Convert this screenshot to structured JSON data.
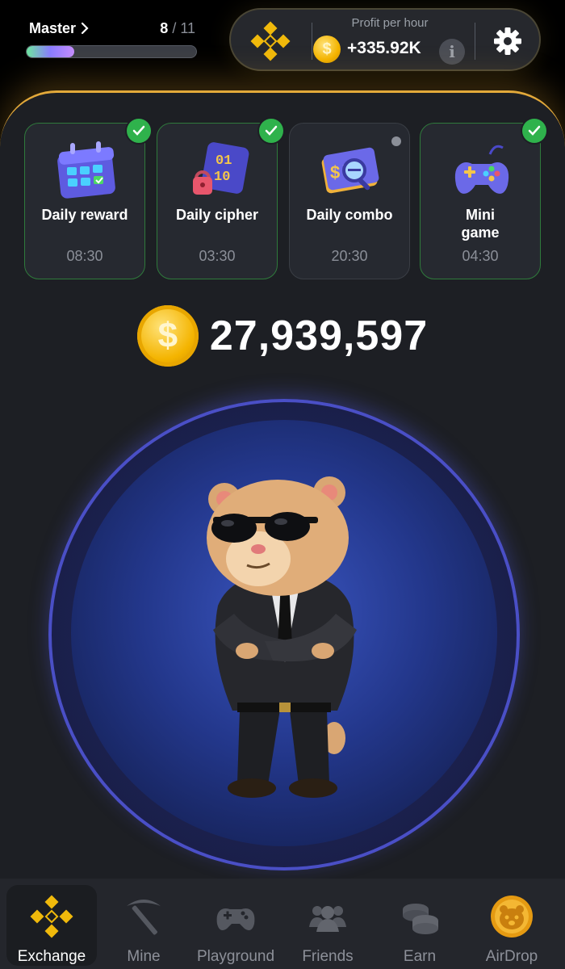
{
  "header": {
    "level_name": "Master",
    "level_current": "8",
    "level_total": "/ 11",
    "level_progress": 0.28,
    "profit_label": "Profit per hour",
    "profit_value": "+335.92K",
    "info_glyph": "i"
  },
  "cards": [
    {
      "title": "Daily reward",
      "time": "08:30",
      "completed": true,
      "icon": "calendar-icon"
    },
    {
      "title": "Daily cipher",
      "time": "03:30",
      "completed": true,
      "icon": "cipher-icon"
    },
    {
      "title": "Daily combo",
      "time": "20:30",
      "completed": false,
      "icon": "combo-icon"
    },
    {
      "title": "Mini\ngame",
      "title_line1": "Mini",
      "title_line2": "game",
      "time": "04:30",
      "completed": true,
      "icon": "gamepad-icon"
    }
  ],
  "balance": {
    "coin_glyph": "$",
    "value": "27,939,597"
  },
  "nav": [
    {
      "label": "Exchange",
      "active": true,
      "icon": "exchange-icon"
    },
    {
      "label": "Mine",
      "active": false,
      "icon": "pickaxe-icon"
    },
    {
      "label": "Playground",
      "active": false,
      "icon": "gamepad-icon"
    },
    {
      "label": "Friends",
      "active": false,
      "icon": "friends-icon"
    },
    {
      "label": "Earn",
      "active": false,
      "icon": "coins-icon"
    },
    {
      "label": "AirDrop",
      "active": false,
      "icon": "airdrop-coin-icon"
    }
  ],
  "colors": {
    "accent_gold": "#e3a93a",
    "panel_bg": "#1d1f24",
    "completed_green": "#2fb24c",
    "tap_ring": "#4a4fc6"
  }
}
